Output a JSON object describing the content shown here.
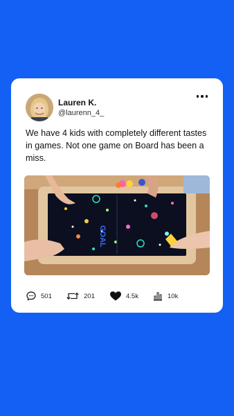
{
  "post": {
    "author_name": "Lauren K.",
    "author_handle": "@laurenn_4_",
    "text": "We have 4 kids with completely different tastes in games. Not one game on Board has been a miss.",
    "image_label": "GOAL"
  },
  "stats": {
    "replies": "501",
    "reposts": "201",
    "likes": "4.5k",
    "views": "10k"
  },
  "colors": {
    "background": "#1460F5",
    "card": "#FFFFFF",
    "text": "#111111"
  },
  "icons": [
    "comment-icon",
    "repost-icon",
    "heart-icon",
    "views-icon",
    "more-icon"
  ]
}
